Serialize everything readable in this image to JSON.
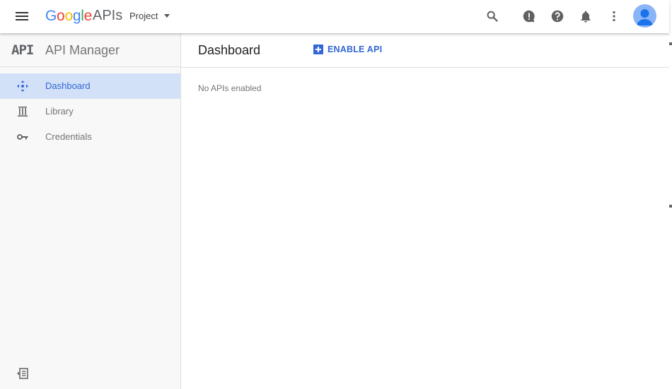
{
  "header": {
    "logo_letters": [
      "G",
      "o",
      "o",
      "g",
      "l",
      "e"
    ],
    "logo_suffix": "APIs",
    "project_label": "Project",
    "icons": [
      "menu-icon",
      "search-icon",
      "feedback-icon",
      "help-icon",
      "notifications-icon",
      "more-vert-icon",
      "avatar-icon"
    ]
  },
  "sidebar": {
    "mark": "API",
    "title": "API Manager",
    "items": [
      {
        "label": "Dashboard",
        "icon": "dashboard-icon",
        "active": true
      },
      {
        "label": "Library",
        "icon": "library-icon",
        "active": false
      },
      {
        "label": "Credentials",
        "icon": "key-icon",
        "active": false
      }
    ],
    "collapse_icon": "collapse-sidebar-icon"
  },
  "main": {
    "title": "Dashboard",
    "enable_label": "ENABLE API",
    "empty_message": "No APIs enabled"
  },
  "colors": {
    "accent": "#3367d6",
    "active_bg": "#d2e1f8",
    "sidebar_bg": "#f8f8f8",
    "google_blue": "#4285f4",
    "google_red": "#ea4335",
    "google_yellow": "#fbbc05",
    "google_green": "#34a853"
  }
}
